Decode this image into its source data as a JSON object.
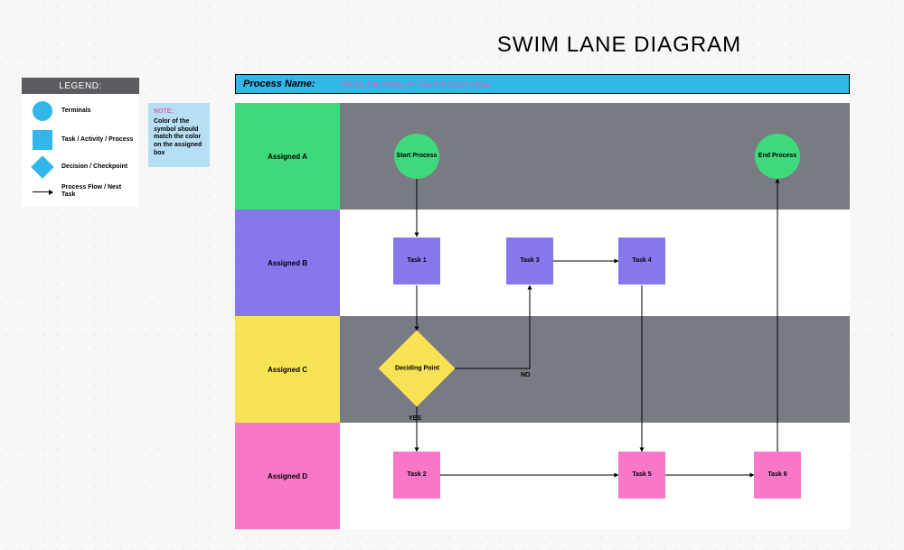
{
  "title": "SWIM LANE DIAGRAM",
  "legend": {
    "header": "LEGEND:",
    "items": [
      {
        "label": "Terminals"
      },
      {
        "label": "Task / Activity / Process"
      },
      {
        "label": "Decision / Checkpoint"
      },
      {
        "label": "Process Flow / Next Task"
      }
    ]
  },
  "note": {
    "title": "NOTE:",
    "body": "Color of the symbol should match the color on the assigned box"
  },
  "process_header": {
    "label": "Process Name:",
    "placeholder": "WRITE THE NAME OF THE PROCESS HERE"
  },
  "lanes": [
    {
      "id": "A",
      "label": "Assigned A",
      "color": "#3fd97c",
      "bg": "#787c82"
    },
    {
      "id": "B",
      "label": "Assigned B",
      "color": "#8677ed",
      "bg": "#ffffff"
    },
    {
      "id": "C",
      "label": "Assigned C",
      "color": "#f7e353",
      "bg": "#787c82"
    },
    {
      "id": "D",
      "label": "Assigned D",
      "color": "#f877c9",
      "bg": "#ffffff"
    }
  ],
  "nodes": {
    "start": {
      "lane": "A",
      "type": "terminal",
      "label": "Start Process"
    },
    "end": {
      "lane": "A",
      "type": "terminal",
      "label": "End Process"
    },
    "task1": {
      "lane": "B",
      "type": "task",
      "label": "Task 1"
    },
    "task3": {
      "lane": "B",
      "type": "task",
      "label": "Task 3"
    },
    "task4": {
      "lane": "B",
      "type": "task",
      "label": "Task 4"
    },
    "decide": {
      "lane": "C",
      "type": "decision",
      "label": "Deciding Point"
    },
    "task2": {
      "lane": "D",
      "type": "task",
      "label": "Task 2"
    },
    "task5": {
      "lane": "D",
      "type": "task",
      "label": "Task 5"
    },
    "task6": {
      "lane": "D",
      "type": "task",
      "label": "Task 6"
    }
  },
  "edges": [
    {
      "from": "start",
      "to": "task1"
    },
    {
      "from": "task1",
      "to": "decide"
    },
    {
      "from": "decide",
      "to": "task3",
      "label": "NO"
    },
    {
      "from": "decide",
      "to": "task2",
      "label": "YES"
    },
    {
      "from": "task3",
      "to": "task4"
    },
    {
      "from": "task4",
      "to": "task5"
    },
    {
      "from": "task2",
      "to": "task5"
    },
    {
      "from": "task5",
      "to": "task6"
    },
    {
      "from": "task6",
      "to": "end"
    }
  ],
  "edge_labels": {
    "no": "NO",
    "yes": "YES"
  }
}
